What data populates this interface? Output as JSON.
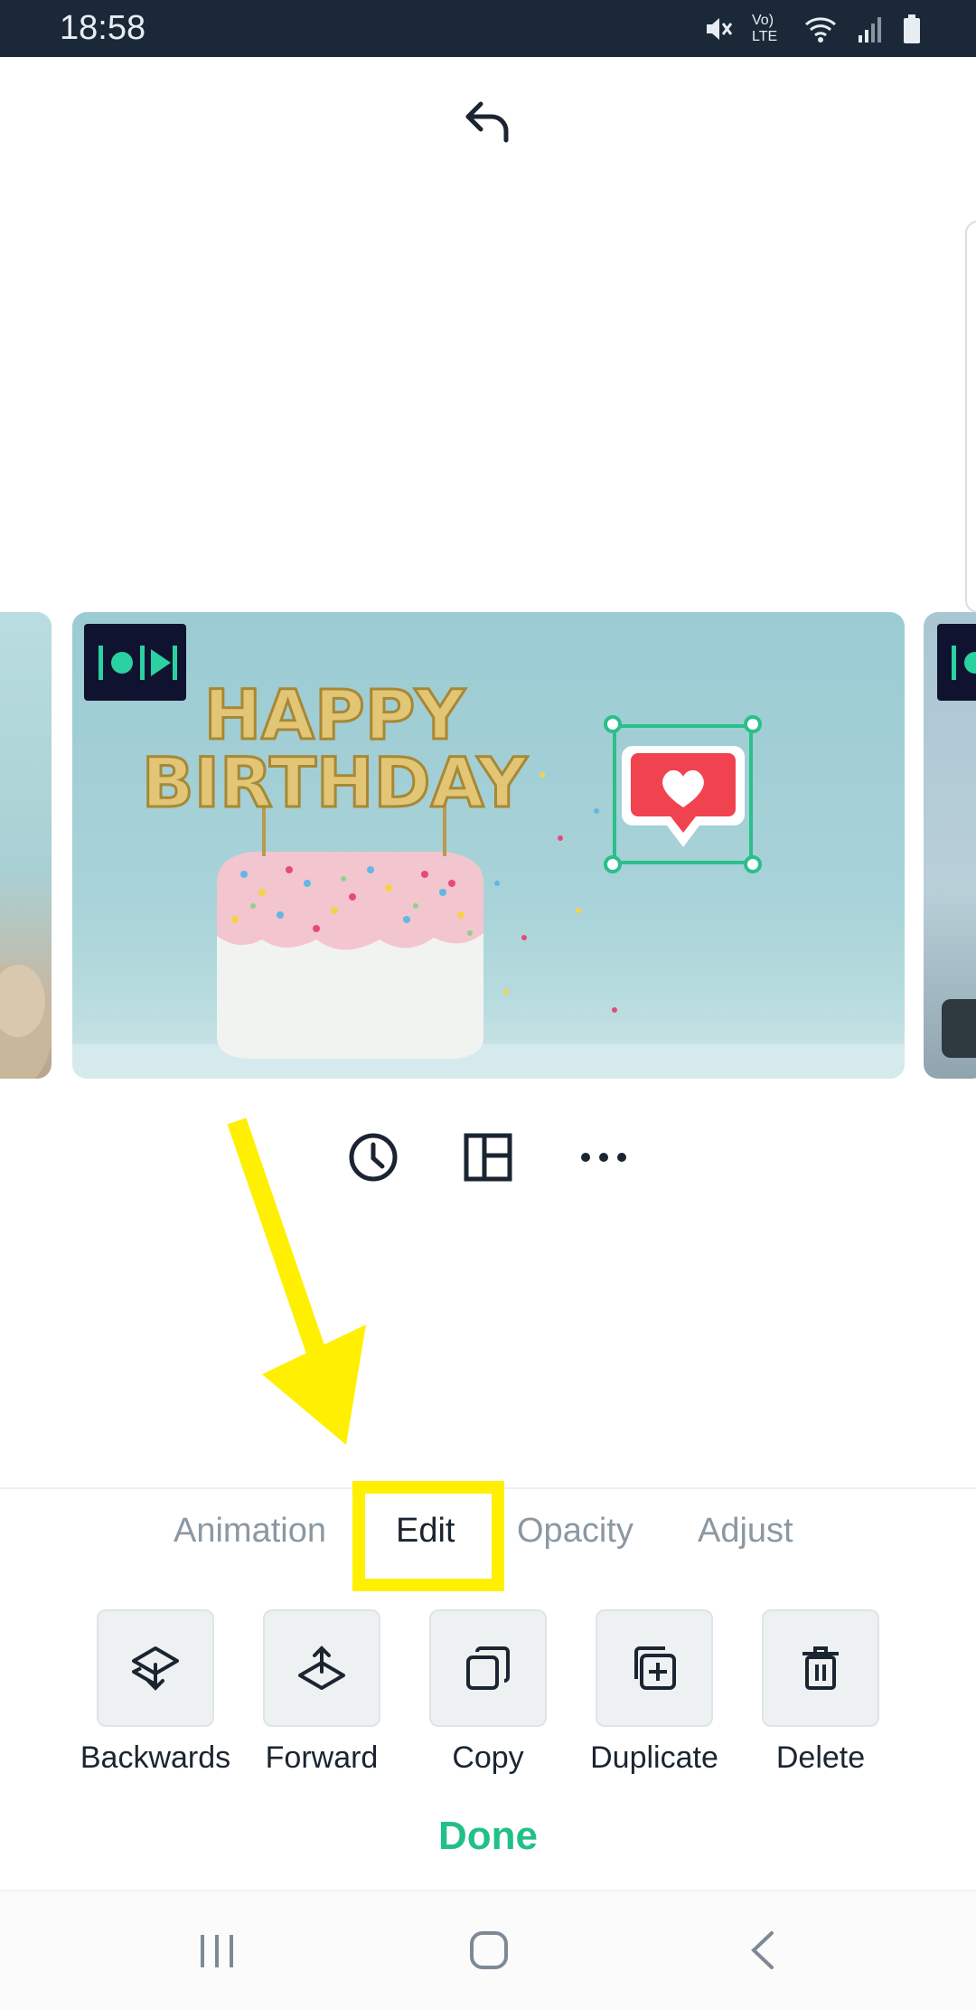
{
  "status_bar": {
    "time": "18:58",
    "icons": [
      "mute-icon",
      "volte-icon",
      "wifi-icon",
      "signal-icon",
      "battery-icon"
    ],
    "volte_label": "Vo) LTE"
  },
  "header": {
    "undo_icon": "undo-icon"
  },
  "slide": {
    "sticker": "heart-speech-bubble",
    "colors": {
      "sticker_red": "#f0434f",
      "selection": "#2bbf8a",
      "badge": "#0f1330",
      "badge_glyph": "#2bd1a0"
    },
    "cake_topper_line1": "HAPPY",
    "cake_topper_line2": "BIRTHDAY"
  },
  "slide_tools": {
    "icons": [
      "clock-icon",
      "layout-icon",
      "more-icon"
    ]
  },
  "tabs": [
    {
      "label": "Animation"
    },
    {
      "label": "Edit",
      "selected": true
    },
    {
      "label": "Opacity"
    },
    {
      "label": "Adjust"
    }
  ],
  "actions": [
    {
      "label": "Backwards",
      "icon": "send-backward-icon"
    },
    {
      "label": "Forward",
      "icon": "bring-forward-icon"
    },
    {
      "label": "Copy",
      "icon": "copy-icon"
    },
    {
      "label": "Duplicate",
      "icon": "duplicate-icon"
    },
    {
      "label": "Delete",
      "icon": "trash-icon"
    }
  ],
  "done_label": "Done",
  "colors": {
    "accent": "#21c086",
    "highlight": "#ffef00",
    "status_bar": "#1b2838"
  }
}
